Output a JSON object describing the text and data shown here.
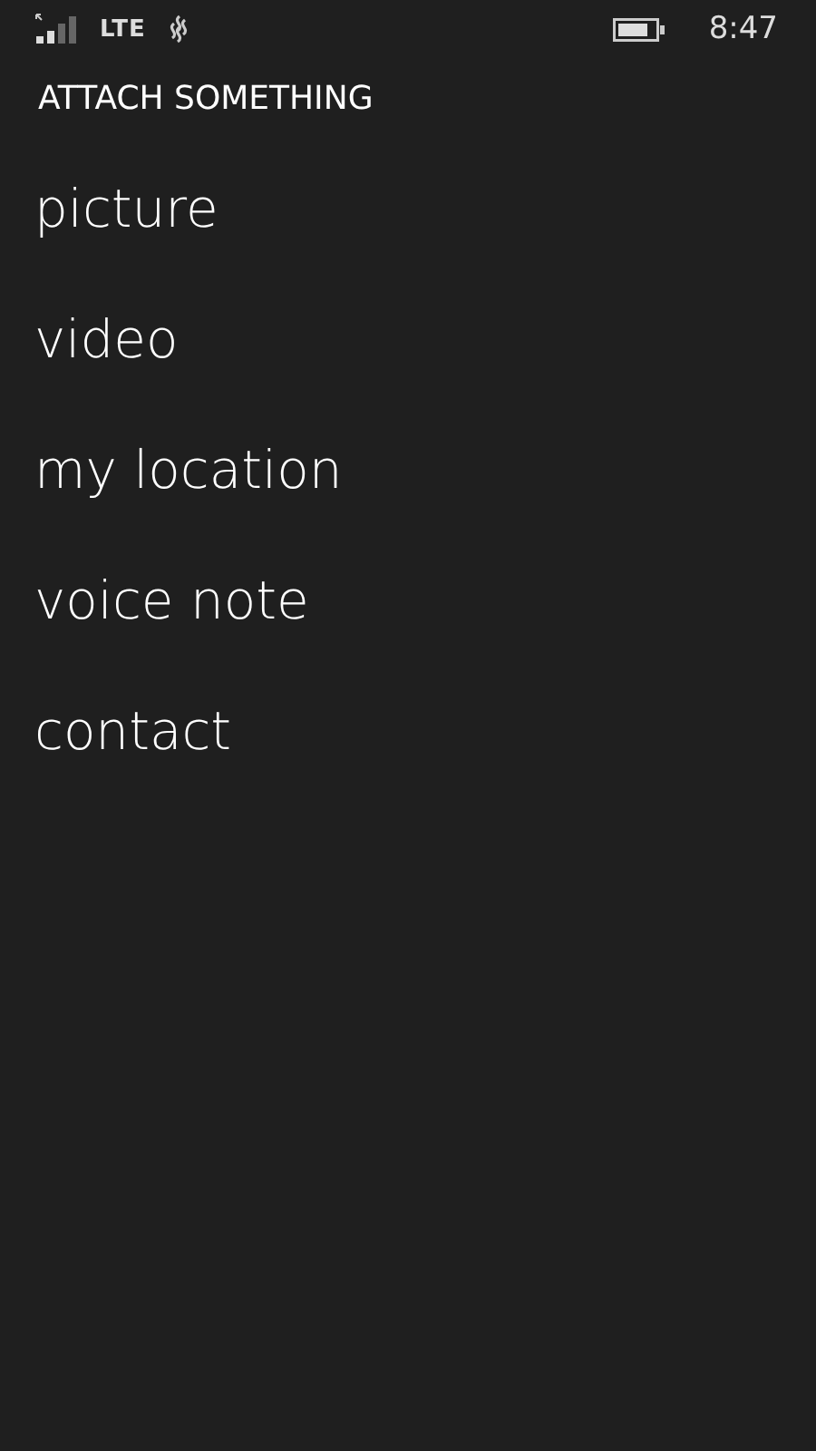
{
  "status_bar": {
    "network": "LTE",
    "time": "8:47"
  },
  "title": "ATTACH SOMETHING",
  "items": [
    {
      "label": "picture"
    },
    {
      "label": "video"
    },
    {
      "label": "my location"
    },
    {
      "label": "voice note"
    },
    {
      "label": "contact"
    }
  ]
}
